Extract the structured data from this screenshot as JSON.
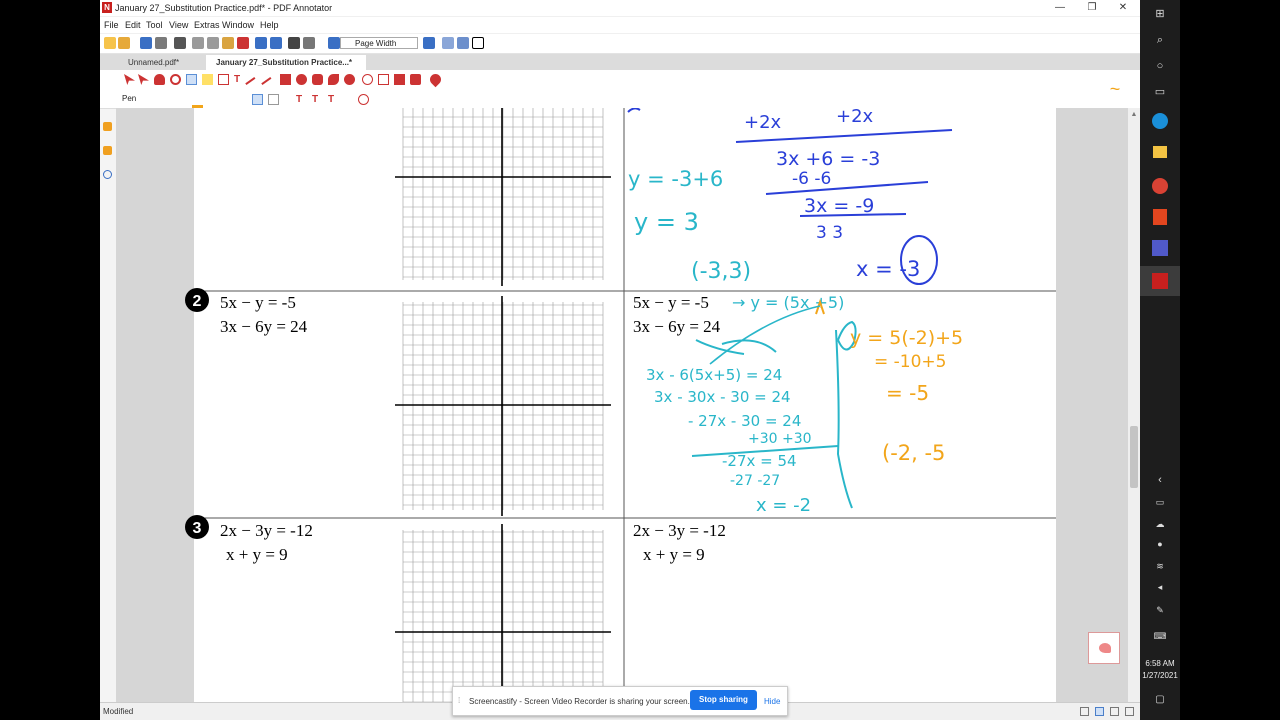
{
  "app": {
    "title": "January 27_Substitution Practice.pdf* - PDF Annotator",
    "title_icon": "N"
  },
  "window_controls": {
    "minimize": "—",
    "maximize": "❐",
    "close": "✕"
  },
  "menu": [
    "File",
    "Edit",
    "Tool",
    "View",
    "Extras",
    "Window",
    "Help"
  ],
  "toolbar": {
    "zoom_value": "Page Width"
  },
  "tabs": [
    {
      "label": "Unnamed.pdf*",
      "active": false
    },
    {
      "label": "January 27_Substitution Practice...*",
      "active": true
    }
  ],
  "tool_options": {
    "pen_label": "Pen"
  },
  "status": {
    "text": "Modified"
  },
  "share_bar": {
    "message": "Screencastify - Screen Video Recorder is sharing your screen.",
    "stop_label": "Stop sharing",
    "hide_label": "Hide"
  },
  "clock": {
    "time": "6:58 AM",
    "date": "1/27/2021"
  },
  "colors": {
    "teal_ink": "#29b6c9",
    "blue_ink": "#2a3fd8",
    "orange_ink": "#f2a51a",
    "accent_red": "#c8201e",
    "share_blue": "#1a73e8"
  },
  "worksheet": {
    "problems": [
      {
        "number": "2",
        "left_lines": [
          "5x − y = -5",
          "3x − 6y = 24"
        ],
        "right_lines": [
          "5x − y = -5",
          "3x − 6y = 24"
        ]
      },
      {
        "number": "3",
        "left_lines": [
          "2x − 3y = -12",
          "x + y = 9"
        ],
        "right_lines": [
          "2x − 3y = -12",
          "x + y = 9"
        ]
      }
    ],
    "handwriting": {
      "p1_blue": [
        "+2x",
        "+2x",
        "3x +6 = -3",
        "-6 -6",
        "3x = -9",
        "3 3",
        "x = -3"
      ],
      "p1_teal": [
        "y = -3+6",
        "y = 3",
        "(-3,3)"
      ],
      "p2_teal": [
        "→ y = (5x +5)",
        "3x - 6(5x+5) = 24",
        "3x - 30x - 30 = 24",
        "- 27x - 30 = 24",
        "+30 +30",
        "-27x = 54",
        "-27 -27",
        "x = -2"
      ],
      "p2_orange": [
        "y = 5(-2)+5",
        "= -10+5",
        "= -5",
        "(-2, -5"
      ]
    }
  }
}
